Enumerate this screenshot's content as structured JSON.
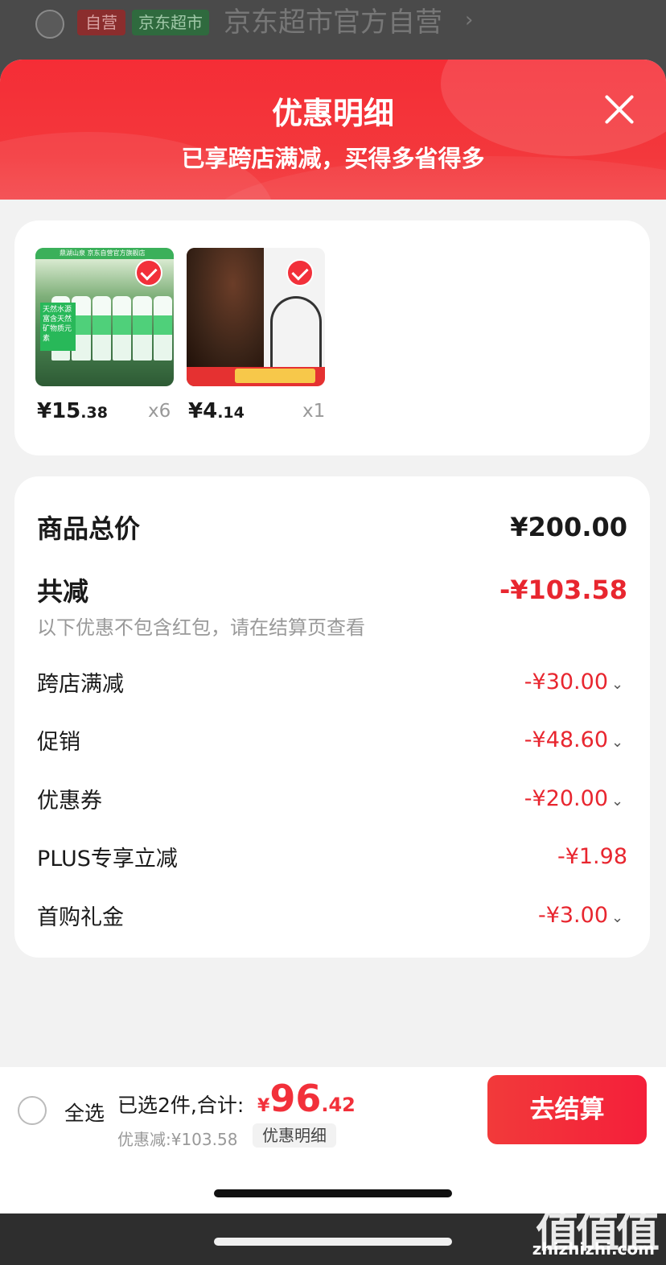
{
  "background": {
    "tag_self": "自营",
    "tag_supermarket": "京东超市",
    "store_name": "京东超市官方自营",
    "chevron": "›"
  },
  "sheet": {
    "title": "优惠明细",
    "subtitle": "已享跨店满减，买得多省得多"
  },
  "products": [
    {
      "price_int": "¥15",
      "price_dec": ".38",
      "qty": "x6",
      "band_text": "鼎湖山泉 京东自营官方旗舰店",
      "label_text": "天然水源 富含天然 矿物质元素"
    },
    {
      "price_int": "¥4",
      "price_dec": ".14",
      "qty": "x1"
    }
  ],
  "detail": {
    "total_label": "商品总价",
    "total_value": "¥200.00",
    "reduce_label": "共减",
    "reduce_value": "-¥103.58",
    "note": "以下优惠不包含红包，请在结算页查看",
    "items": [
      {
        "label": "跨店满减",
        "value": "-¥30.00",
        "chev": "⌄"
      },
      {
        "label": "促销",
        "value": "-¥48.60",
        "chev": "⌄"
      },
      {
        "label": "优惠券",
        "value": "-¥20.00",
        "chev": "⌄"
      },
      {
        "label": "PLUS专享立减",
        "value": "-¥1.98",
        "chev": ""
      },
      {
        "label": "首购礼金",
        "value": "-¥3.00",
        "chev": "⌄"
      }
    ]
  },
  "bottom_bar": {
    "select_all": "全选",
    "selected_text": "已选2件,合计:",
    "total_yen": "¥",
    "total_int": "96",
    "total_dec": ".42",
    "saved_text": "优惠减:¥103.58",
    "detail_chip": "优惠明细",
    "checkout": "去结算"
  },
  "watermark": {
    "logo": "值值值",
    "url": "zhizhizhi.com"
  },
  "colors": {
    "accent_red": "#f2303a",
    "discount_red": "#e8262f"
  }
}
